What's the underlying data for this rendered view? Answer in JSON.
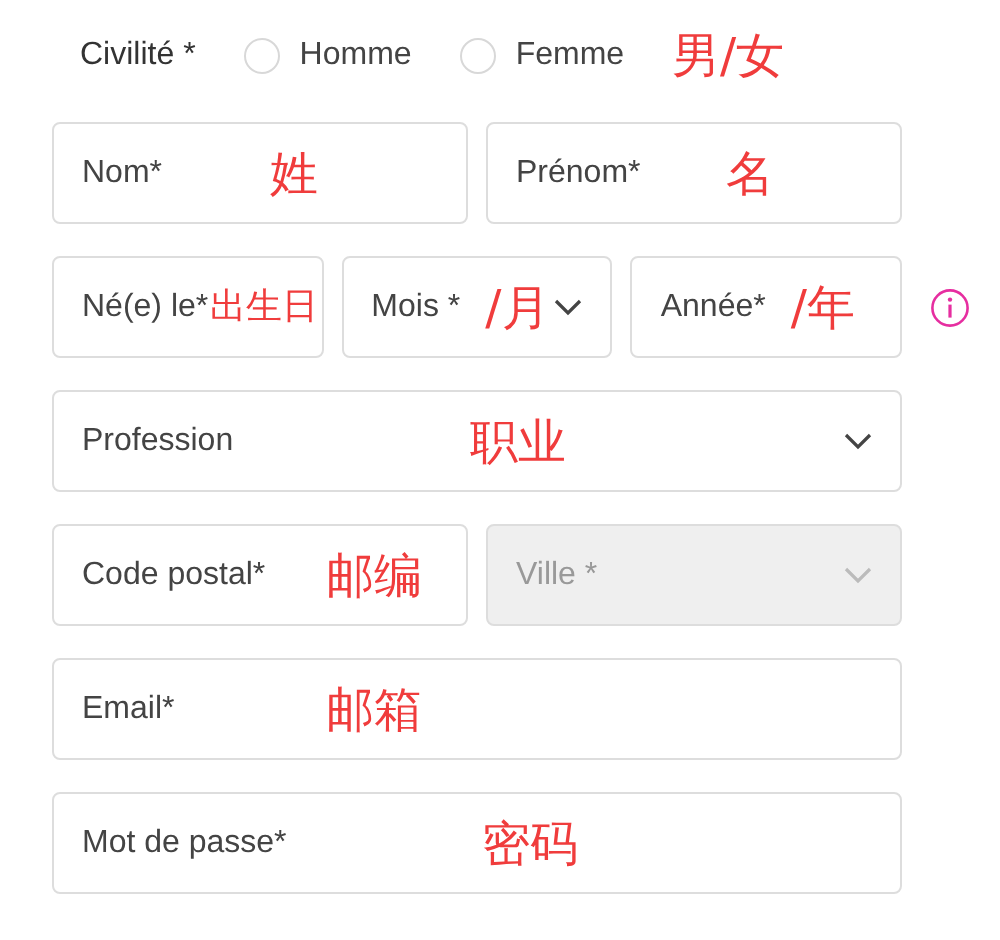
{
  "civility": {
    "label": "Civilité *",
    "options": [
      {
        "label": "Homme",
        "selected": false
      },
      {
        "label": "Femme",
        "selected": false
      }
    ],
    "note": "男/女"
  },
  "rows": [
    {
      "info": false,
      "fields": [
        {
          "kind": "input",
          "placeholder": "Nom*",
          "note": "姓"
        },
        {
          "kind": "input",
          "placeholder": "Prénom*",
          "note": "名"
        }
      ]
    },
    {
      "info": true,
      "fields": [
        {
          "kind": "input",
          "placeholder": "Né(e) le*",
          "note": "出生日"
        },
        {
          "kind": "select",
          "text": "Mois *",
          "note": "/月",
          "disabled": false
        },
        {
          "kind": "input",
          "placeholder": "Année*",
          "note": "/年"
        }
      ]
    },
    {
      "info": false,
      "fields": [
        {
          "kind": "select",
          "text": "Profession",
          "note": "职业",
          "disabled": false
        }
      ]
    },
    {
      "info": false,
      "fields": [
        {
          "kind": "input",
          "placeholder": "Code postal*",
          "note": "邮编"
        },
        {
          "kind": "select",
          "text": "Ville *",
          "disabled": true
        }
      ]
    },
    {
      "info": false,
      "fields": [
        {
          "kind": "input",
          "placeholder": "Email*",
          "note": "邮箱"
        }
      ]
    },
    {
      "info": false,
      "fields": [
        {
          "kind": "input",
          "placeholder": "Mot de passe*",
          "note": "密码"
        }
      ]
    }
  ]
}
